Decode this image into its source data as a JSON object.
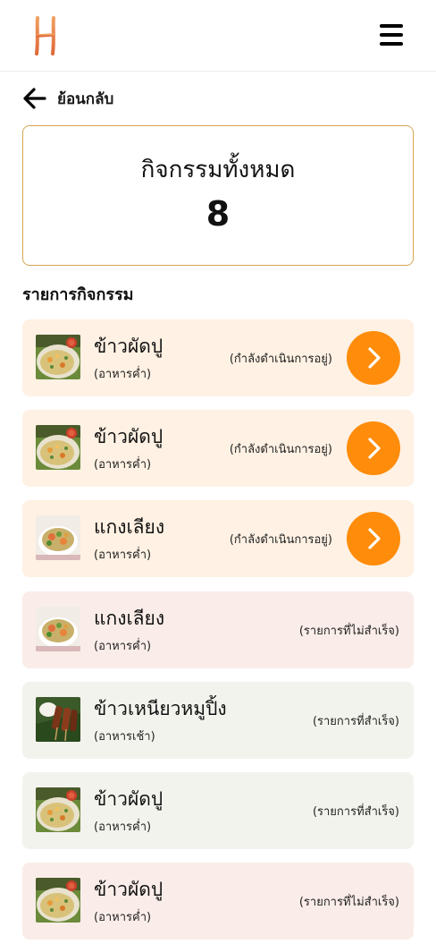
{
  "header": {
    "logo": "logo-h",
    "menu_icon": "hamburger-icon"
  },
  "back": {
    "label": "ย้อนกลับ",
    "icon": "arrow-left-icon"
  },
  "summary": {
    "title": "กิจกรรมทั้งหมด",
    "count": "8"
  },
  "section_title": "รายการกิจกรรม",
  "colors": {
    "accent": "#ff8c0a",
    "summary_border": "#d5a552",
    "in_progress_bg": "#fff1e3",
    "failed_bg": "#faede9",
    "success_bg": "#f3f3ee"
  },
  "activities": [
    {
      "name": "ข้าวผัดปู",
      "meal": "(อาหารค่ำ)",
      "status": "(กำลังดำเนินการอยู่)",
      "state": "in-progress",
      "image": "crab-fried-rice"
    },
    {
      "name": "ข้าวผัดปู",
      "meal": "(อาหารค่ำ)",
      "status": "(กำลังดำเนินการอยู่)",
      "state": "in-progress",
      "image": "crab-fried-rice"
    },
    {
      "name": "แกงเลียง",
      "meal": "(อาหารค่ำ)",
      "status": "(กำลังดำเนินการอยู่)",
      "state": "in-progress",
      "image": "kaeng-liang-soup"
    },
    {
      "name": "แกงเลียง",
      "meal": "(อาหารค่ำ)",
      "status": "(รายการที่ไม่สำเร็จ)",
      "state": "failed",
      "image": "kaeng-liang-soup"
    },
    {
      "name": "ข้าวเหนียวหมูปิ้ง",
      "meal": "(อาหารเช้า)",
      "status": "(รายการที่สำเร็จ)",
      "state": "success",
      "image": "grilled-pork-sticky-rice"
    },
    {
      "name": "ข้าวผัดปู",
      "meal": "(อาหารค่ำ)",
      "status": "(รายการที่สำเร็จ)",
      "state": "success",
      "image": "crab-fried-rice"
    },
    {
      "name": "ข้าวผัดปู",
      "meal": "(อาหารค่ำ)",
      "status": "(รายการที่ไม่สำเร็จ)",
      "state": "failed",
      "image": "crab-fried-rice"
    }
  ]
}
